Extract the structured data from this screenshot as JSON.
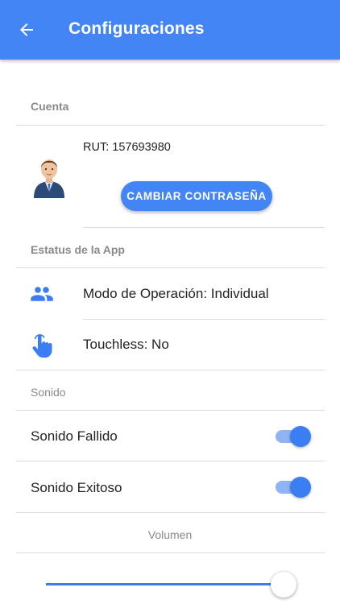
{
  "appbar": {
    "title": "Configuraciones",
    "back_icon": "arrow-left-icon"
  },
  "account": {
    "header": "Cuenta",
    "rut": "RUT: 157693980",
    "change_password_label": "CAMBIAR CONTRASEÑA",
    "avatar_icon": "user-avatar-icon"
  },
  "app_status": {
    "header": "Estatus de la App",
    "operation_mode": "Modo de Operación: Individual",
    "operation_icon": "group-icon",
    "touchless": "Touchless: No",
    "touchless_icon": "hand-pointer-icon"
  },
  "sound": {
    "header": "Sonido",
    "failed_label": "Sonido Fallido",
    "failed_on": true,
    "success_label": "Sonido Exitoso",
    "success_on": true
  },
  "volume": {
    "label": "Volumen",
    "level": 0.95
  },
  "colors": {
    "primary": "#4385f5",
    "accent": "#3b7ef3",
    "muted": "#8a8a8a"
  }
}
